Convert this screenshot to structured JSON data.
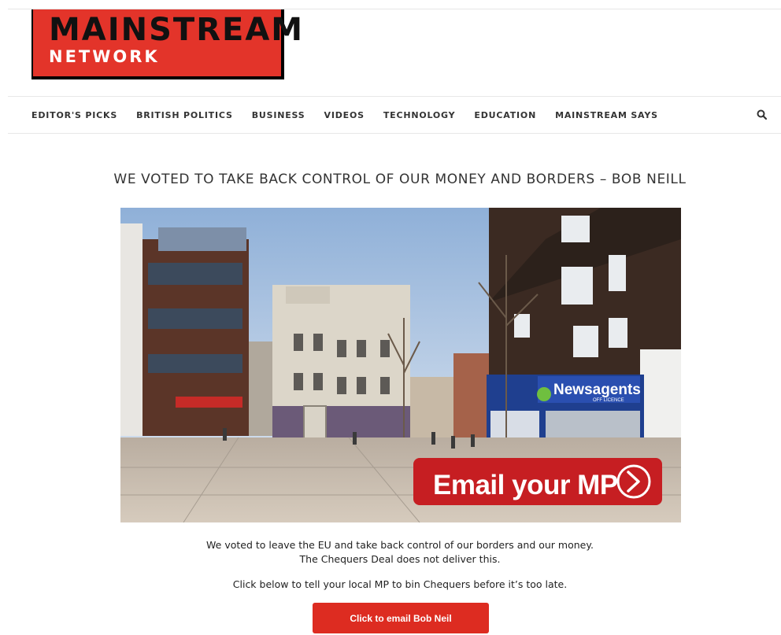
{
  "logo": {
    "main": "MAINSTREAM",
    "sub": "NETWORK"
  },
  "nav": {
    "items": [
      "EDITOR'S PICKS",
      "BRITISH POLITICS",
      "BUSINESS",
      "VIDEOS",
      "TECHNOLOGY",
      "EDUCATION",
      "MAINSTREAM SAYS"
    ],
    "search_icon": "search-icon"
  },
  "article": {
    "title": "WE VOTED TO TAKE BACK CONTROL OF OUR MONEY AND BORDERS – BOB NEILL",
    "image": {
      "shop_sign": "Newsagents",
      "shop_sign_sub": "OFF LICENCE",
      "cta_label": "Email your MP",
      "cta_icon": "chevron-right-circle-icon"
    },
    "paragraph_line1": "We voted to leave the EU and take back control of our borders and our money.",
    "paragraph_line2": "The Chequers Deal does not deliver this.",
    "paragraph2": "Click below to tell your local MP to bin Chequers before it’s too late.",
    "button_label": "Click to email Bob Neil"
  },
  "colors": {
    "brand_red": "#e3342a",
    "button_red": "#dd2c21"
  }
}
